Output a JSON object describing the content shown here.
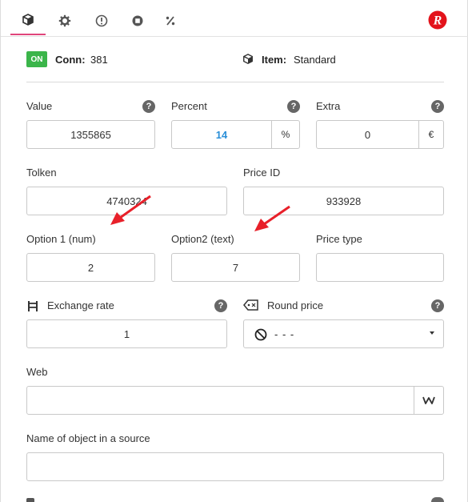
{
  "tabs": [
    {
      "icon": "cube-icon"
    },
    {
      "icon": "gear-icon"
    },
    {
      "icon": "alert-circle-icon"
    },
    {
      "icon": "stop-circle-icon"
    },
    {
      "icon": "percent-icon"
    }
  ],
  "logo_letter": "R",
  "status": {
    "badge": "ON",
    "conn_label": "Conn:",
    "conn_value": "381",
    "item_label": "Item:",
    "item_value": "Standard"
  },
  "fields": {
    "value": {
      "label": "Value",
      "value": "1355865"
    },
    "percent": {
      "label": "Percent",
      "value": "14",
      "addon": "%"
    },
    "extra": {
      "label": "Extra",
      "value": "0",
      "addon": "€"
    },
    "tolken": {
      "label": "Tolken",
      "value": "4740324"
    },
    "price_id": {
      "label": "Price ID",
      "value": "933928"
    },
    "option1": {
      "label": "Option 1 (num)",
      "value": "2"
    },
    "option2": {
      "label": "Option2 (text)",
      "value": "7"
    },
    "price_type": {
      "label": "Price type",
      "value": ""
    },
    "exchange_rate": {
      "label": "Exchange rate",
      "value": "1"
    },
    "round_price": {
      "label": "Round price",
      "value": "- - -"
    },
    "web": {
      "label": "Web",
      "value": ""
    },
    "source_name": {
      "label": "Name of object in a source",
      "value": ""
    }
  },
  "help_glyph": "?",
  "colors": {
    "accent": "#e0457b",
    "on_green": "#3bb54a",
    "percent_blue": "#2a8fd8",
    "arrow_red": "#e8202a"
  }
}
